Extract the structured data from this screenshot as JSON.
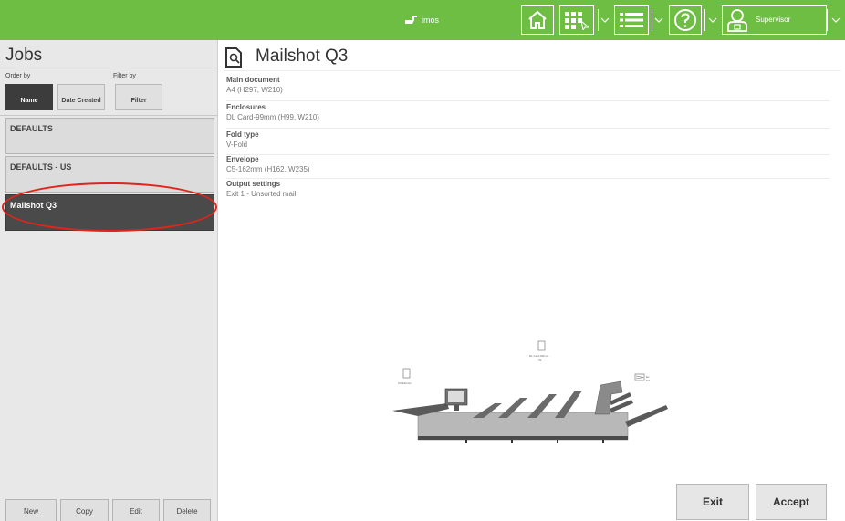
{
  "topbar": {
    "brand": "imos",
    "icons": [
      "home-icon",
      "job-grid-icon",
      "menu-icon",
      "help-icon",
      "user-icon"
    ],
    "user": "Supervisor",
    "bg_color": "#6fbe44"
  },
  "jobs_panel": {
    "title": "Jobs",
    "order_by_label": "Order by",
    "filter_by_label": "Filter by",
    "sort_name": "Name",
    "sort_date": "Date Created",
    "filter_button": "Filter",
    "items": [
      {
        "label": "DEFAULTS"
      },
      {
        "label": "DEFAULTS - US"
      },
      {
        "label": "Mailshot Q3",
        "selected": true
      }
    ],
    "actions": {
      "new": "New",
      "copy": "Copy",
      "edit": "Edit",
      "delete": "Delete"
    }
  },
  "job_detail": {
    "title": "Mailshot Q3",
    "sections": [
      {
        "label": "Main document",
        "value": "A4 (H297, W210)"
      },
      {
        "label": "Enclosures",
        "value": "DL Card-99mm (H99, W210)"
      },
      {
        "label": "Fold type",
        "value": "V-Fold"
      },
      {
        "label": "Envelope",
        "value": "C5-162mm (H162, W235)"
      },
      {
        "label": "Output settings",
        "value": "Exit 1 - Unsorted mail"
      }
    ],
    "machine_labels": {
      "envelope": "C5-162mm",
      "enclosure": "DL Card-99mm",
      "enclosure_sub": "V1",
      "output": "Ex",
      "output_sub": "1-1"
    }
  },
  "footer": {
    "exit": "Exit",
    "accept": "Accept"
  }
}
